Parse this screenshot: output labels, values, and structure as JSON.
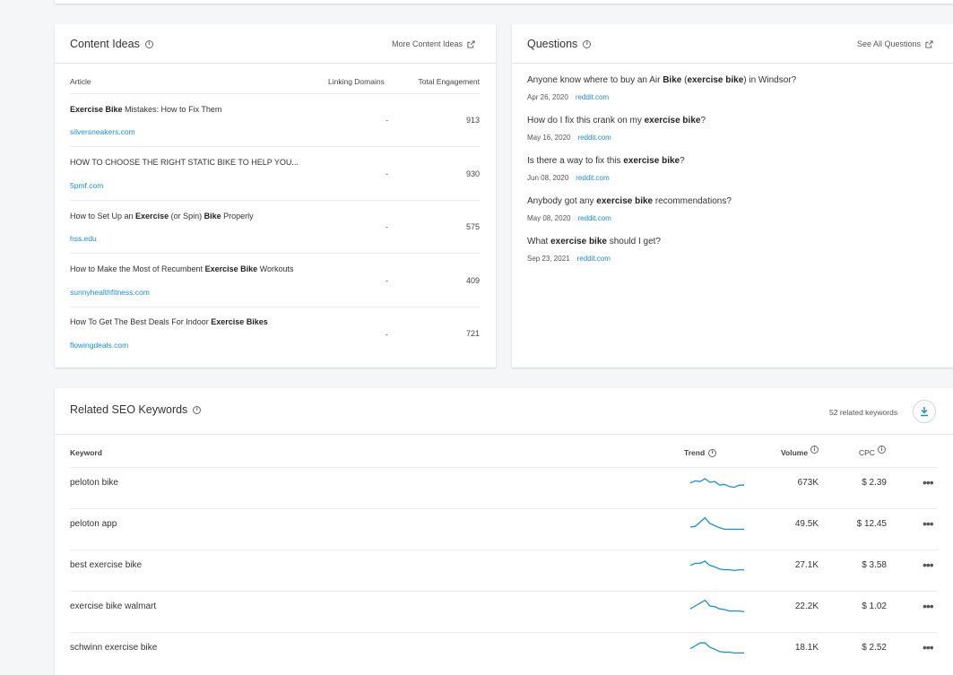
{
  "content_ideas": {
    "title": "Content Ideas",
    "more_link": "More Content Ideas",
    "headers": {
      "article": "Article",
      "linking": "Linking Domains",
      "engagement": "Total Engagement"
    },
    "rows": [
      {
        "title_bold": "Exercise Bike",
        "title_rest": " Mistakes: How to Fix Them",
        "domain": "silversneakers.com",
        "linking": "-",
        "engagement": "913"
      },
      {
        "title_plain": "HOW TO CHOOSE THE RIGHT STATIC BIKE TO HELP YOU...",
        "domain": "5pmf.com",
        "linking": "-",
        "engagement": "930"
      },
      {
        "title_pre": "How to Set Up an ",
        "title_b1": "Exercise",
        "title_mid": " (or Spin) ",
        "title_b2": "Bike",
        "title_post": " Properly",
        "domain": "hss.edu",
        "linking": "-",
        "engagement": "575"
      },
      {
        "title_pre": "How to Make the Most of Recumbent ",
        "title_b1": "Exercise Bike",
        "title_post": " Workouts",
        "domain": "sunnyhealthfitness.com",
        "linking": "-",
        "engagement": "409"
      },
      {
        "title_pre": "How To Get The Best Deals For Indoor ",
        "title_b1": "Exercise Bikes",
        "domain": "flowingdeals.com",
        "linking": "-",
        "engagement": "721"
      }
    ]
  },
  "questions": {
    "title": "Questions",
    "see_all": "See All Questions",
    "items": [
      {
        "pre": "Anyone know where to buy an Air ",
        "b1": "Bike",
        "mid": " (",
        "b2": "exercise bike",
        "post": ") in Windsor?",
        "date": "Apr 26, 2020",
        "source": "reddit.com"
      },
      {
        "pre": "How do I fix this crank on my ",
        "b1": "exercise bike",
        "post": "?",
        "date": "May 16, 2020",
        "source": "reddit.com"
      },
      {
        "pre": "Is there a way to fix this ",
        "b1": "exercise bike",
        "post": "?",
        "date": "Jun 08, 2020",
        "source": "reddit.com"
      },
      {
        "pre": "Anybody got any ",
        "b1": "exercise bike",
        "post": " recommendations?",
        "date": "May 08, 2020",
        "source": "reddit.com"
      },
      {
        "pre": "What ",
        "b1": "exercise bike",
        "post": " should I get?",
        "date": "Sep 23, 2021",
        "source": "reddit.com"
      }
    ]
  },
  "related": {
    "title": "Related SEO Keywords",
    "count": "52 related keywords",
    "headers": {
      "keyword": "Keyword",
      "trend": "Trend",
      "volume": "Volume",
      "cpc": "CPC"
    },
    "trend_color": "#1a8fd6",
    "rows": [
      {
        "keyword": "peloton bike",
        "volume": "673K",
        "cpc": "$ 2.39",
        "trend": [
          0.45,
          0.6,
          0.55,
          0.75,
          0.5,
          0.55,
          0.3,
          0.35,
          0.2,
          0.15,
          0.3,
          0.3
        ]
      },
      {
        "keyword": "peloton app",
        "volume": "49.5K",
        "cpc": "$ 12.45",
        "trend": [
          0.25,
          0.3,
          0.6,
          0.9,
          0.5,
          0.35,
          0.2,
          0.1,
          0.1,
          0.1,
          0.1,
          0.1
        ]
      },
      {
        "keyword": "best exercise bike",
        "volume": "27.1K",
        "cpc": "$ 3.58",
        "trend": [
          0.45,
          0.6,
          0.6,
          0.75,
          0.45,
          0.35,
          0.2,
          0.15,
          0.15,
          0.1,
          0.15,
          0.15
        ]
      },
      {
        "keyword": "exercise bike walmart",
        "volume": "22.2K",
        "cpc": "$ 1.02",
        "trend": [
          0.3,
          0.5,
          0.7,
          0.9,
          0.5,
          0.45,
          0.3,
          0.25,
          0.15,
          0.15,
          0.15,
          0.1
        ]
      },
      {
        "keyword": "schwinn exercise bike",
        "volume": "18.1K",
        "cpc": "$ 2.52",
        "trend": [
          0.4,
          0.6,
          0.8,
          0.8,
          0.5,
          0.35,
          0.2,
          0.15,
          0.15,
          0.1,
          0.1,
          0.1
        ]
      }
    ],
    "more_label": "•••"
  }
}
